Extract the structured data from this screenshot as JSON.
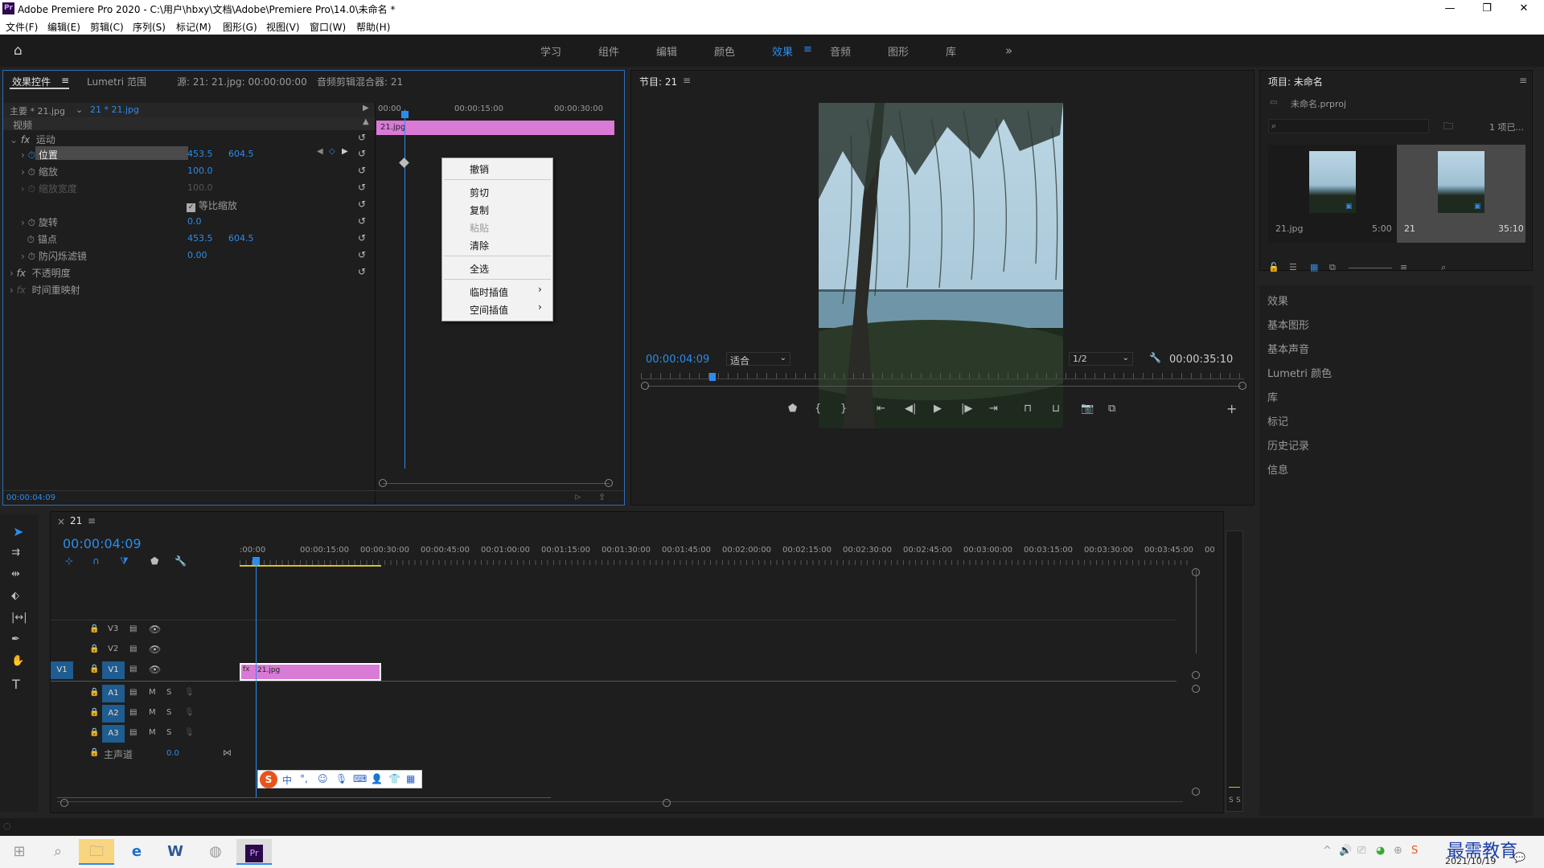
{
  "window": {
    "title": "Adobe Premiere Pro 2020 - C:\\用户\\hbxy\\文档\\Adobe\\Premiere Pro\\14.0\\未命名 *",
    "logo": "Pr"
  },
  "menu": [
    "文件(F)",
    "编辑(E)",
    "剪辑(C)",
    "序列(S)",
    "标记(M)",
    "图形(G)",
    "视图(V)",
    "窗口(W)",
    "帮助(H)"
  ],
  "workspaces": [
    "学习",
    "组件",
    "编辑",
    "颜色",
    "效果",
    "音频",
    "图形",
    "库"
  ],
  "effect_controls": {
    "tabs": [
      "效果控件",
      "Lumetri 范围",
      "源: 21: 21.jpg: 00:00:00:00",
      "音频剪辑混合器: 21"
    ],
    "master": "主要 * 21.jpg",
    "clip": "21 * 21.jpg",
    "ruler": [
      "00:00",
      "00:00:15:00",
      "00:00:30:00"
    ],
    "clip_label": "21.jpg",
    "section": "视频",
    "motion": "运动",
    "props": [
      {
        "name": "位置",
        "v1": "453.5",
        "v2": "604.5"
      },
      {
        "name": "缩放",
        "v1": "100.0",
        "v2": ""
      },
      {
        "name": "缩放宽度",
        "v1": "100.0",
        "v2": ""
      },
      {
        "name": "等比缩放",
        "v1": "",
        "v2": ""
      },
      {
        "name": "旋转",
        "v1": "0.0",
        "v2": ""
      },
      {
        "name": "锚点",
        "v1": "453.5",
        "v2": "604.5"
      },
      {
        "name": "防闪烁滤镜",
        "v1": "0.00",
        "v2": ""
      }
    ],
    "opacity": "不透明度",
    "timeremap": "时间重映射",
    "timecode": "00:00:04:09"
  },
  "context_menu": {
    "items": [
      "撤销",
      "剪切",
      "复制",
      "粘贴",
      "清除",
      "全选",
      "临时插值",
      "空间插值"
    ]
  },
  "program": {
    "title": "节目: 21",
    "timecode": "00:00:04:09",
    "fit": "适合",
    "quality": "1/2",
    "duration": "00:00:35:10"
  },
  "project": {
    "title": "项目: 未命名",
    "file": "未命名.prproj",
    "count": "1 项已...",
    "items": [
      {
        "name": "21.jpg",
        "dur": "5:00"
      },
      {
        "name": "21",
        "dur": "35:10"
      }
    ]
  },
  "right_panels": [
    "效果",
    "基本图形",
    "基本声音",
    "Lumetri 颜色",
    "库",
    "标记",
    "历史记录",
    "信息"
  ],
  "timeline": {
    "tab": "21",
    "timecode": "00:00:04:09",
    "ruler": [
      ":00:00",
      "00:00:15:00",
      "00:00:30:00",
      "00:00:45:00",
      "00:01:00:00",
      "00:01:15:00",
      "00:01:30:00",
      "00:01:45:00",
      "00:02:00:00",
      "00:02:15:00",
      "00:02:30:00",
      "00:02:45:00",
      "00:03:00:00",
      "00:03:15:00",
      "00:03:30:00",
      "00:03:45:00",
      "00"
    ],
    "video_tracks": [
      "V3",
      "V2",
      "V1"
    ],
    "audio_tracks": [
      "A1",
      "A2",
      "A3"
    ],
    "master": "主声道",
    "master_val": "0.0",
    "clip": "21.jpg",
    "src_patch": "V1"
  },
  "taskbar": {
    "time": "",
    "date": "2021/10/19",
    "watermark": "最需教育"
  }
}
